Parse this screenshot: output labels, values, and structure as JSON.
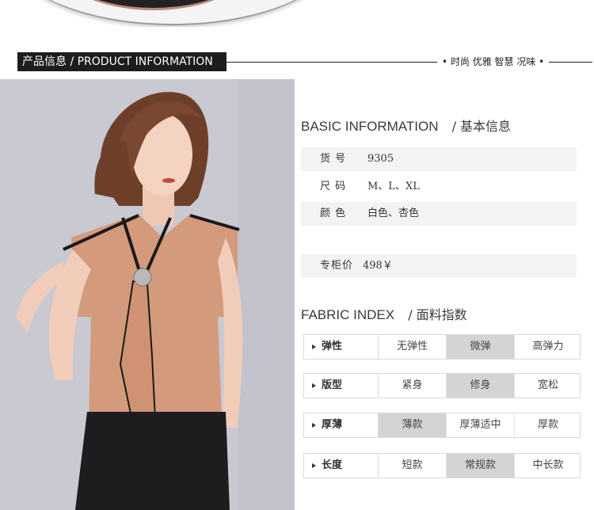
{
  "section": {
    "title": "产品信息 / PRODUCT INFORMATION",
    "slogan": "• 时尚 优雅 智慧 况味 •"
  },
  "basic": {
    "heading_en": "BASIC INFORMATION",
    "heading_cn": "/ 基本信息",
    "rows": [
      {
        "label": "货  号",
        "value": "9305"
      },
      {
        "label": "尺  码",
        "value": "M、L、XL"
      },
      {
        "label": "颜  色",
        "value": "白色、杏色"
      }
    ],
    "price": {
      "label": "专柜价",
      "value": "498￥"
    }
  },
  "fabric": {
    "heading_en": "FABRIC INDEX",
    "heading_cn": "/ 面料指数",
    "rows": [
      {
        "label": "弹性",
        "options": [
          "无弹性",
          "微弹",
          "高弹力"
        ],
        "selected": 1
      },
      {
        "label": "版型",
        "options": [
          "紧身",
          "修身",
          "宽松"
        ],
        "selected": 1
      },
      {
        "label": "厚薄",
        "options": [
          "薄款",
          "厚薄适中",
          "厚款"
        ],
        "selected": 0
      },
      {
        "label": "长度",
        "options": [
          "短款",
          "常规款",
          "中长款"
        ],
        "selected": 1
      }
    ]
  },
  "colors": {
    "photo_bg": "#c8c9d1",
    "blouse": "#d49a7c",
    "trim": "#1a1a1a",
    "selected_cell": "#d4d4d4",
    "row_bg": "#f3f3f3"
  }
}
